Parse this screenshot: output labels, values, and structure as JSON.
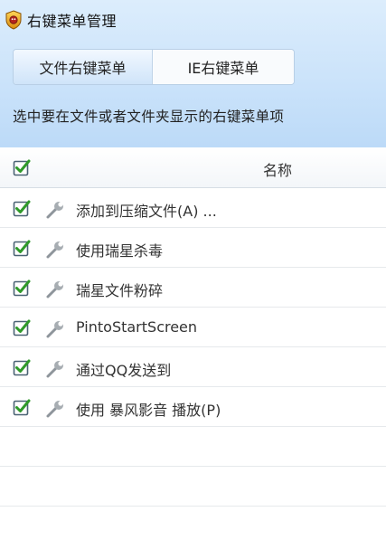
{
  "window": {
    "title": "右键菜单管理",
    "app_icon": "shield-badge-icon"
  },
  "tabs": [
    {
      "label": "文件右键菜单",
      "active": true
    },
    {
      "label": "IE右键菜单",
      "active": false
    }
  ],
  "description": "选中要在文件或者文件夹显示的右键菜单项",
  "table": {
    "select_all_checked": true,
    "columns": [
      "名称"
    ],
    "rows": [
      {
        "checked": true,
        "icon": "wrench-icon",
        "label": "添加到压缩文件(A) ..."
      },
      {
        "checked": true,
        "icon": "wrench-icon",
        "label": "使用瑞星杀毒"
      },
      {
        "checked": true,
        "icon": "wrench-icon",
        "label": "瑞星文件粉碎"
      },
      {
        "checked": true,
        "icon": "wrench-icon",
        "label": "PintoStartScreen"
      },
      {
        "checked": true,
        "icon": "wrench-icon",
        "label": "通过QQ发送到"
      },
      {
        "checked": true,
        "icon": "wrench-icon",
        "label": "使用 暴风影音 播放(P)"
      }
    ]
  },
  "colors": {
    "header_gradient_top": "#dcedfc",
    "header_gradient_bottom": "#bcdaf8",
    "check_green": "#2f9a2a",
    "checkbox_border": "#4a6274"
  }
}
